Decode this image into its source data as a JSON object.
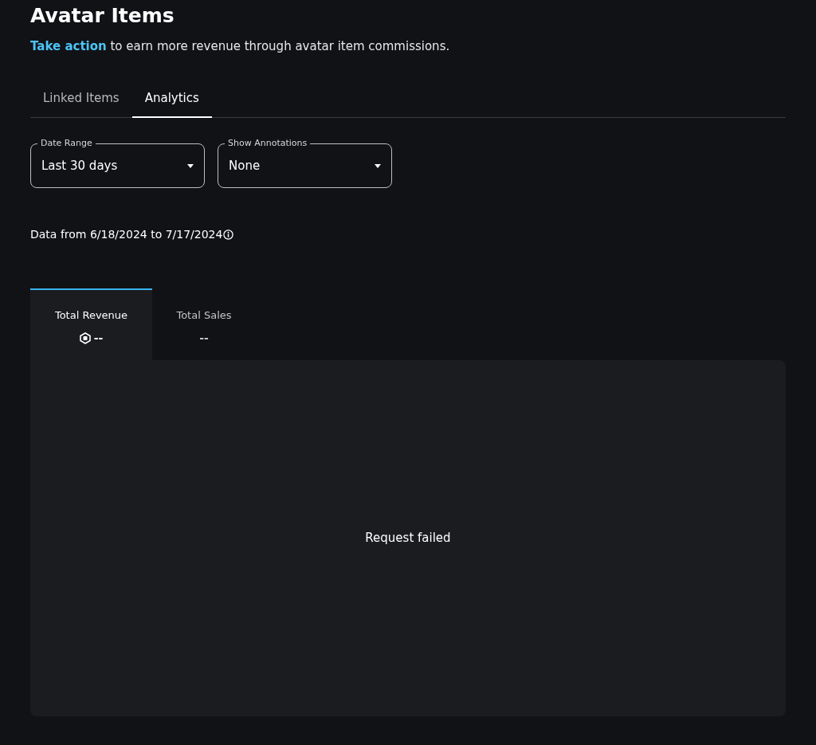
{
  "header": {
    "title": "Avatar Items",
    "link": "Take action",
    "subtitle": " to earn more revenue through avatar item commissions."
  },
  "tabs": [
    {
      "label": "Linked Items",
      "selected": false
    },
    {
      "label": "Analytics",
      "selected": true
    }
  ],
  "filters": [
    {
      "label": "Date Range",
      "value": "Last 30 days"
    },
    {
      "label": "Show Annotations",
      "value": "None"
    }
  ],
  "date_note": "Data from 6/18/2024 to 7/17/2024",
  "metrics": [
    {
      "label": "Total Revenue",
      "value": "--",
      "kind": "currency",
      "selected": true
    },
    {
      "label": "Total Sales",
      "value": "--",
      "kind": "count",
      "selected": false
    }
  ],
  "chart_panel": {
    "message": "Request failed"
  }
}
